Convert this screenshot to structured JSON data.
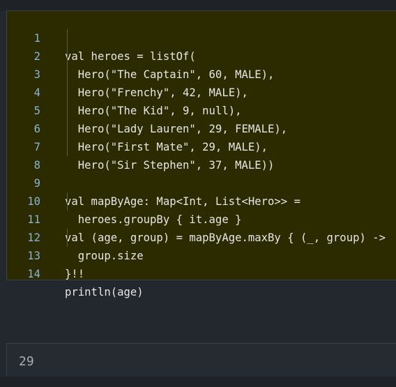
{
  "editor": {
    "lines": [
      {
        "num": "1",
        "code": "val heroes = listOf("
      },
      {
        "num": "2",
        "code": "  Hero(\"The Captain\", 60, MALE),"
      },
      {
        "num": "3",
        "code": "  Hero(\"Frenchy\", 42, MALE),"
      },
      {
        "num": "4",
        "code": "  Hero(\"The Kid\", 9, null),"
      },
      {
        "num": "5",
        "code": "  Hero(\"Lady Lauren\", 29, FEMALE),"
      },
      {
        "num": "6",
        "code": "  Hero(\"First Mate\", 29, MALE),"
      },
      {
        "num": "7",
        "code": "  Hero(\"Sir Stephen\", 37, MALE))"
      },
      {
        "num": "8",
        "code": ""
      },
      {
        "num": "9",
        "code": "val mapByAge: Map<Int, List<Hero>> ="
      },
      {
        "num": "10",
        "code": "  heroes.groupBy { it.age }"
      },
      {
        "num": "11",
        "code": "val (age, group) = mapByAge.maxBy { (_, group) ->"
      },
      {
        "num": "12",
        "code": "  group.size"
      },
      {
        "num": "13",
        "code": "}!!"
      },
      {
        "num": "14",
        "code": "println(age)"
      }
    ]
  },
  "output": {
    "text": "29"
  }
}
